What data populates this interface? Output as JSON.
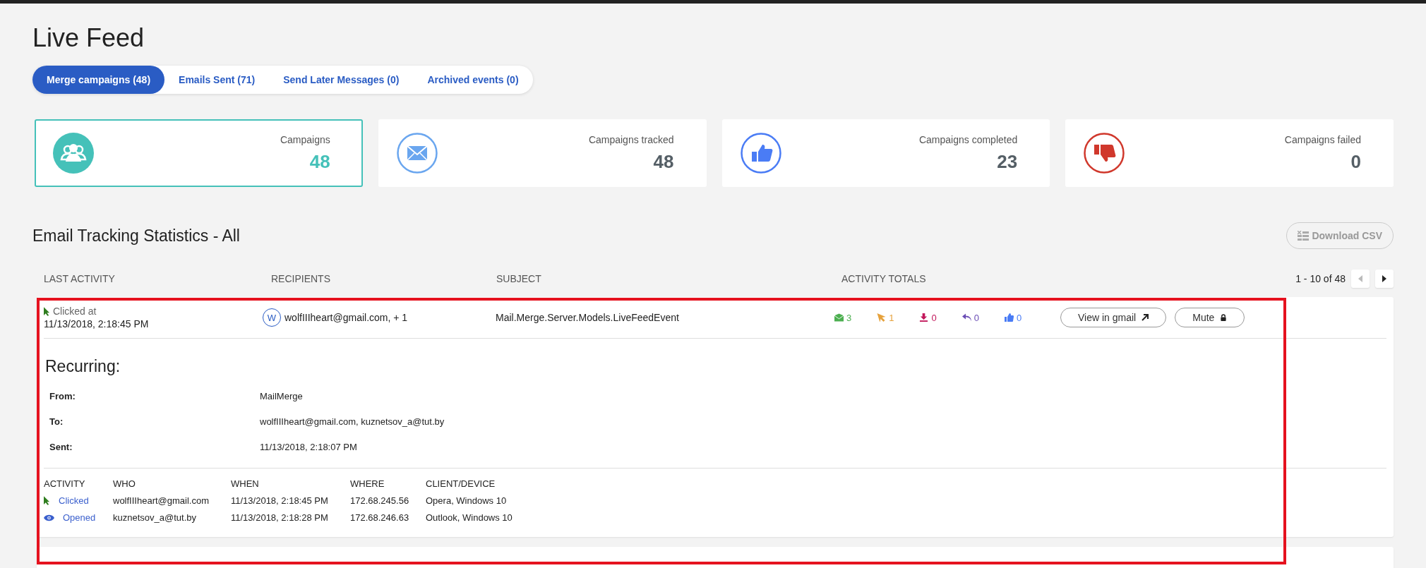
{
  "page_title": "Live Feed",
  "tabs": [
    {
      "label": "Merge campaigns (48)",
      "selected": true
    },
    {
      "label": "Emails Sent (71)",
      "selected": false
    },
    {
      "label": "Send Later Messages (0)",
      "selected": false
    },
    {
      "label": "Archived events (0)",
      "selected": false
    }
  ],
  "stats": [
    {
      "kind": "campaigns",
      "label": "Campaigns",
      "value": "48",
      "selected": true
    },
    {
      "kind": "tracked",
      "label": "Campaigns tracked",
      "value": "48",
      "selected": false
    },
    {
      "kind": "completed",
      "label": "Campaigns completed",
      "value": "23",
      "selected": false
    },
    {
      "kind": "failed",
      "label": "Campaigns failed",
      "value": "0",
      "selected": false
    }
  ],
  "section_title": "Email Tracking Statistics - All",
  "download_button": "Download CSV",
  "table": {
    "columns": [
      "LAST ACTIVITY",
      "RECIPIENTS",
      "SUBJECT",
      "ACTIVITY TOTALS"
    ],
    "pagination": "1 - 10 of 48",
    "rows": [
      {
        "activity": "Clicked at",
        "time": "11/13/2018, 2:18:45 PM",
        "avatar": "W",
        "recipients": "wolfIIIheart@gmail.com, + 1",
        "subject": "Mail.Merge.Server.Models.LiveFeedEvent",
        "totals": [
          {
            "kind": "sent",
            "count": "3"
          },
          {
            "kind": "clicked",
            "count": "1"
          },
          {
            "kind": "downloaded",
            "count": "0"
          },
          {
            "kind": "replied",
            "count": "0"
          },
          {
            "kind": "liked",
            "count": "0"
          }
        ],
        "buttons": [
          {
            "kind": "external",
            "label": "View in gmail"
          },
          {
            "kind": "lock",
            "label": "Mute"
          }
        ],
        "expanded": true,
        "details": {
          "title": "Recurring:",
          "fields": [
            {
              "label": "From:",
              "value": "MailMerge"
            },
            {
              "label": "To:",
              "value": "wolfIIIheart@gmail.com, kuznetsov_a@tut.by"
            },
            {
              "label": "Sent:",
              "value": "11/13/2018, 2:18:07 PM"
            }
          ],
          "columns": [
            "ACTIVITY",
            "WHO",
            "WHEN",
            "WHERE",
            "CLIENT/DEVICE"
          ],
          "events": [
            {
              "kind": "clicked",
              "activity": "Clicked",
              "who": "wolfIIIheart@gmail.com",
              "when": "11/13/2018, 2:18:45 PM",
              "where": "172.68.245.56",
              "client": "Opera, Windows 10"
            },
            {
              "kind": "opened",
              "activity": "Opened",
              "who": "kuznetsov_a@tut.by",
              "when": "11/13/2018, 2:18:28 PM",
              "where": "172.68.246.63",
              "client": "Outlook, Windows 10"
            }
          ]
        }
      }
    ]
  },
  "highlight_frame": true
}
